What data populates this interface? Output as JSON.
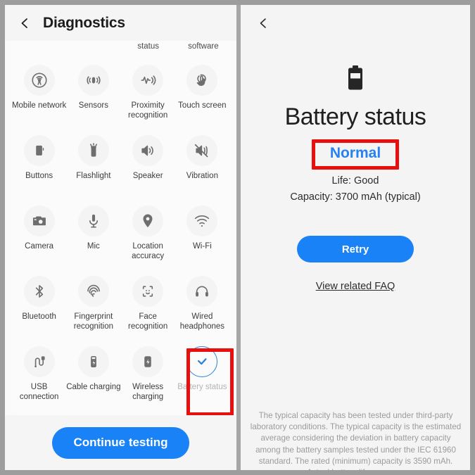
{
  "colors": {
    "accent_blue": "#1a82f7",
    "status_blue": "#2681f2",
    "highlight_red": "#e8100f",
    "panel_bg_left": "#fafafa",
    "panel_bg_right": "#f4f4f4",
    "muted_text": "#b3b3b3"
  },
  "left_panel": {
    "appbar": {
      "back_icon": "chevron-left-icon",
      "title": "Diagnostics"
    },
    "clipped_row_labels": [
      "",
      "",
      "status",
      "software"
    ],
    "tiles": [
      {
        "label": "Mobile network",
        "icon": "mobile-network-icon",
        "state": "pending"
      },
      {
        "label": "Sensors",
        "icon": "sensors-icon",
        "state": "pending"
      },
      {
        "label": "Proximity recognition",
        "icon": "proximity-recognition-icon",
        "state": "pending"
      },
      {
        "label": "Touch screen",
        "icon": "touch-screen-icon",
        "state": "pending"
      },
      {
        "label": "Buttons",
        "icon": "buttons-icon",
        "state": "pending"
      },
      {
        "label": "Flashlight",
        "icon": "flashlight-icon",
        "state": "pending"
      },
      {
        "label": "Speaker",
        "icon": "speaker-icon",
        "state": "pending"
      },
      {
        "label": "Vibration",
        "icon": "vibration-icon",
        "state": "pending"
      },
      {
        "label": "Camera",
        "icon": "camera-icon",
        "state": "pending"
      },
      {
        "label": "Mic",
        "icon": "mic-icon",
        "state": "pending"
      },
      {
        "label": "Location accuracy",
        "icon": "location-pin-icon",
        "state": "pending"
      },
      {
        "label": "Wi-Fi",
        "icon": "wifi-icon",
        "state": "pending"
      },
      {
        "label": "Bluetooth",
        "icon": "bluetooth-icon",
        "state": "pending"
      },
      {
        "label": "Fingerprint recognition",
        "icon": "fingerprint-icon",
        "state": "pending"
      },
      {
        "label": "Face recognition",
        "icon": "face-recognition-icon",
        "state": "pending"
      },
      {
        "label": "Wired headphones",
        "icon": "headphones-icon",
        "state": "pending"
      },
      {
        "label": "USB connection",
        "icon": "usb-cable-icon",
        "state": "pending"
      },
      {
        "label": "Cable charging",
        "icon": "cable-charging-icon",
        "state": "pending"
      },
      {
        "label": "Wireless charging",
        "icon": "wireless-charging-icon",
        "state": "pending"
      },
      {
        "label": "Battery status",
        "icon": "check-circle-icon",
        "state": "done"
      }
    ],
    "cta_label": "Continue testing"
  },
  "right_panel": {
    "back_icon": "chevron-left-icon",
    "battery_icon": "battery-icon",
    "title": "Battery status",
    "status": "Normal",
    "life": "Life: Good",
    "capacity": "Capacity: 3700 mAh (typical)",
    "retry_label": "Retry",
    "faq_label": "View related FAQ",
    "fineprint": "The typical capacity has been tested under third-party laboratory conditions. The typical capacity is the estimated average considering the deviation in battery capacity among the battery samples tested under the IEC 61960 standard. The rated (minimum) capacity is 3590 mAh. Actual battery life may vary"
  }
}
